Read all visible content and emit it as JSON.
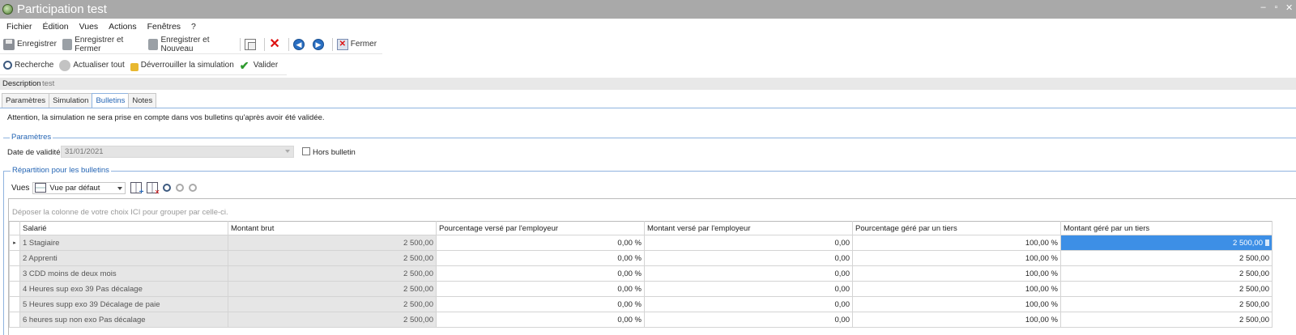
{
  "window": {
    "title": "Participation test",
    "controls": [
      "–",
      "▫",
      "✕"
    ]
  },
  "menu": [
    "Fichier",
    "Édition",
    "Vues",
    "Actions",
    "Fenêtres",
    "?"
  ],
  "toolbar1": {
    "save": "Enregistrer",
    "save_close": "Enregistrer et Fermer",
    "save_new": "Enregistrer et Nouveau",
    "close": "Fermer"
  },
  "toolbar2": {
    "search": "Recherche",
    "refresh": "Actualiser tout",
    "unlock": "Déverrouiller la simulation",
    "validate": "Valider"
  },
  "description": {
    "label": "Description",
    "value": "test"
  },
  "tabs": [
    "Paramètres",
    "Simulation",
    "Bulletins",
    "Notes"
  ],
  "active_tab": "Bulletins",
  "notice": "Attention, la simulation ne sera prise en compte dans vos bulletins qu'après avoir été validée.",
  "params_group": {
    "title": "Paramètres",
    "date_label": "Date de validité",
    "date_value": "31/01/2021",
    "hors_bulletin_label": "Hors bulletin",
    "hors_bulletin_checked": false
  },
  "repartition_group": {
    "title": "Répartition pour les bulletins",
    "vues_label": "Vues",
    "vues_value": "Vue par défaut",
    "group_hint": "Déposer la colonne de votre choix ICI pour grouper par celle-ci."
  },
  "grid": {
    "columns": [
      "Salarié",
      "Montant brut",
      "Pourcentage versé par l'employeur",
      "Montant versé par l'employeur",
      "Pourcentage géré par un tiers",
      "Montant géré par un tiers"
    ],
    "rows": [
      [
        "1 Stagiaire",
        "2 500,00",
        "0,00 %",
        "0,00",
        "100,00 %",
        "2 500,00"
      ],
      [
        "2 Apprenti",
        "2 500,00",
        "0,00 %",
        "0,00",
        "100,00 %",
        "2 500,00"
      ],
      [
        "3 CDD moins de deux mois",
        "2 500,00",
        "0,00 %",
        "0,00",
        "100,00 %",
        "2 500,00"
      ],
      [
        "4 Heures sup exo 39 Pas décalage",
        "2 500,00",
        "0,00 %",
        "0,00",
        "100,00 %",
        "2 500,00"
      ],
      [
        "5 Heures supp exo 39 Décalage de paie",
        "2 500,00",
        "0,00 %",
        "0,00",
        "100,00 %",
        "2 500,00"
      ],
      [
        "6 heures sup non exo Pas décalage",
        "2 500,00",
        "0,00 %",
        "0,00",
        "100,00 %",
        "2 500,00"
      ]
    ],
    "current_row_marker": "▸"
  },
  "colors": {
    "titlebar": "#a9a9a9",
    "accent": "#2565b4",
    "selection": "#3d8fe6",
    "readonly_cell": "#e6e6e6"
  }
}
